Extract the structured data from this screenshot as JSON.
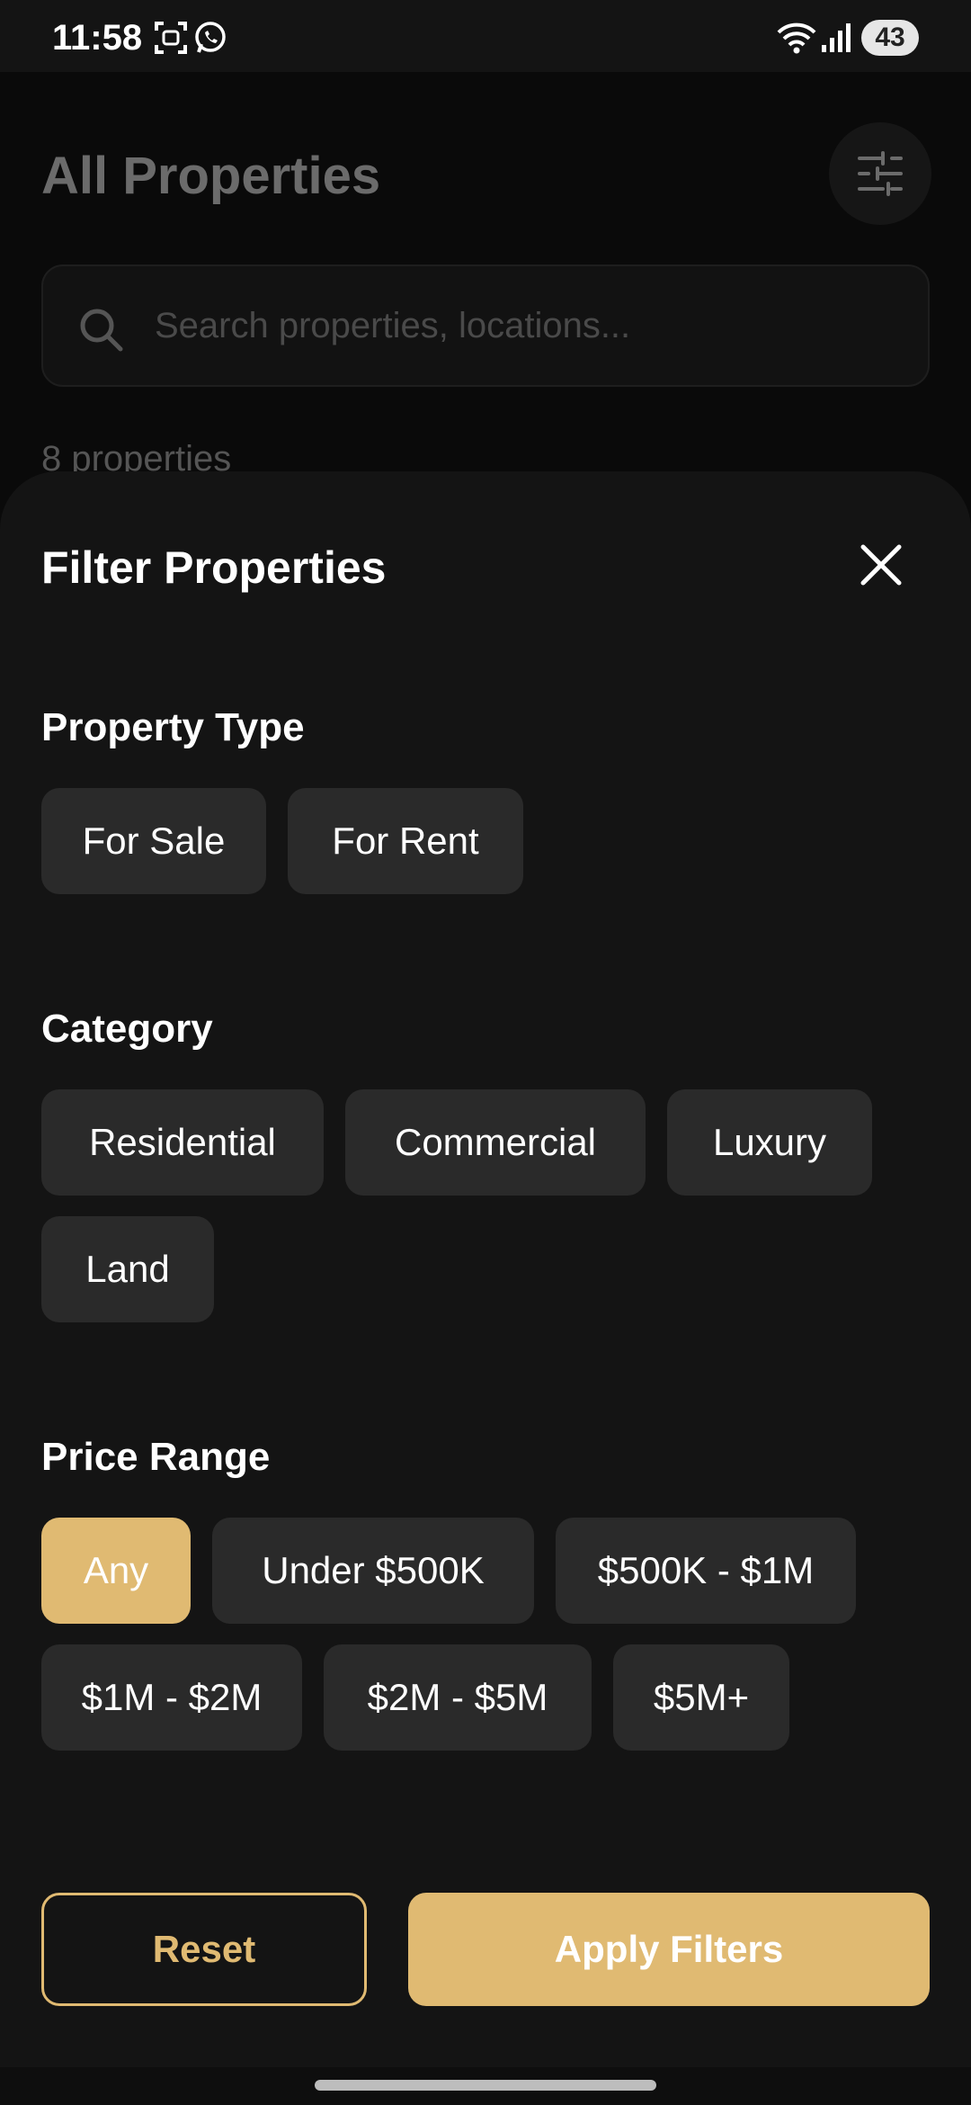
{
  "status_bar": {
    "time": "11:58",
    "battery": "43"
  },
  "page": {
    "title": "All Properties",
    "search_placeholder": "Search properties, locations...",
    "count": "8 properties"
  },
  "sheet": {
    "title": "Filter Properties",
    "property_type": {
      "title": "Property Type",
      "chips": [
        "For Sale",
        "For Rent"
      ]
    },
    "category": {
      "title": "Category",
      "chips": [
        "Residential",
        "Commercial",
        "Luxury",
        "Land"
      ]
    },
    "price_range": {
      "title": "Price Range",
      "chips": [
        "Any",
        "Under $500K",
        "$500K - $1M",
        "$1M - $2M",
        "$2M - $5M",
        "$5M+"
      ],
      "selected": "Any"
    },
    "reset_label": "Reset",
    "apply_label": "Apply Filters"
  },
  "colors": {
    "accent": "#e0ba72",
    "sheet_bg": "#141414",
    "chip_bg": "#2a2a2a"
  }
}
